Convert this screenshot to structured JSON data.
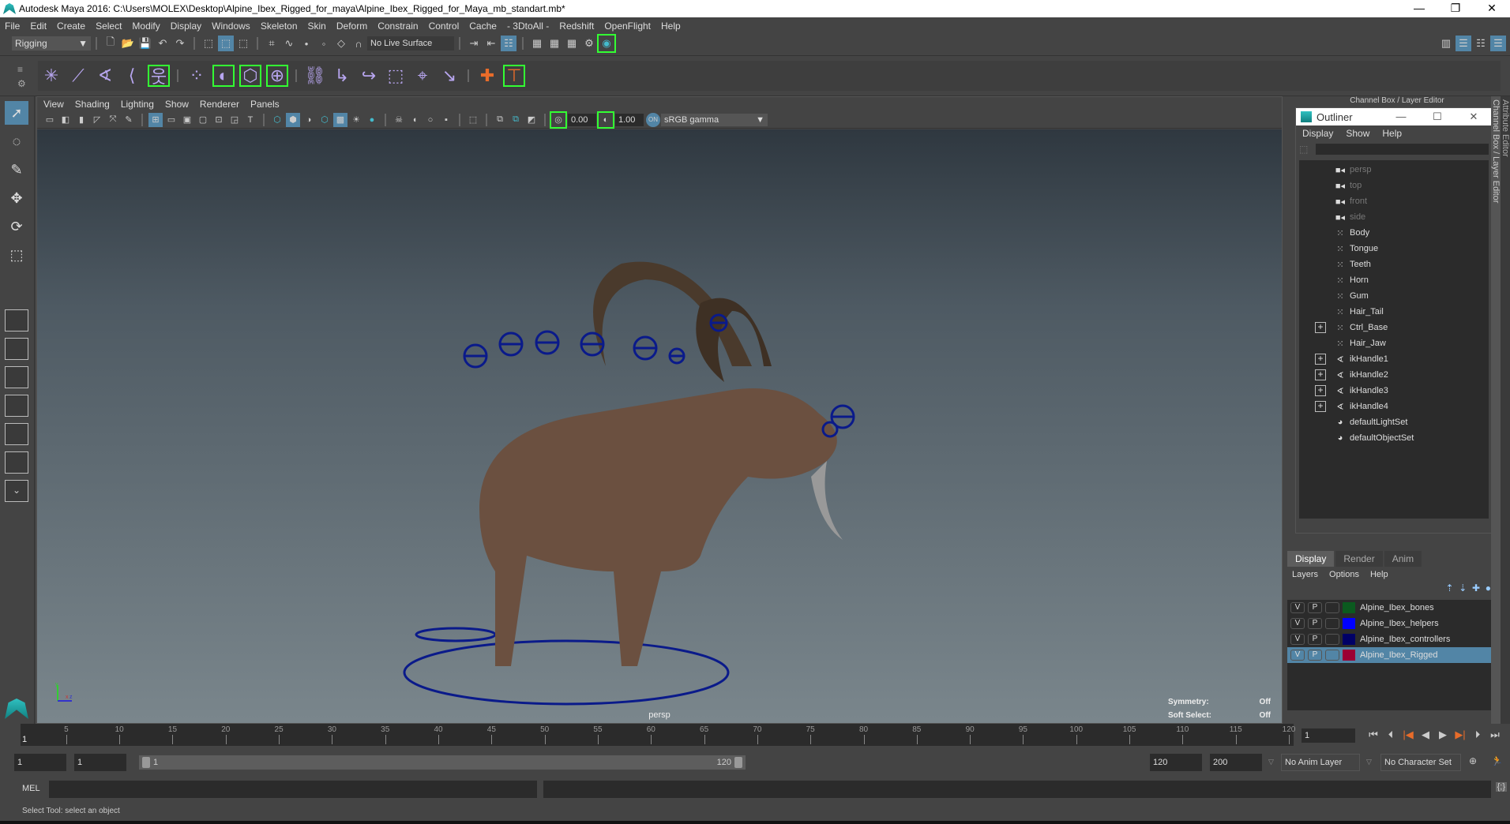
{
  "window": {
    "title": "Autodesk Maya 2016: C:\\Users\\MOLEX\\Desktop\\Alpine_Ibex_Rigged_for_maya\\Alpine_Ibex_Rigged_for_Maya_mb_standart.mb*",
    "minimize": "—",
    "maximize": "❐",
    "close": "✕"
  },
  "menubar": [
    "File",
    "Edit",
    "Create",
    "Select",
    "Modify",
    "Display",
    "Windows",
    "Skeleton",
    "Skin",
    "Deform",
    "Constrain",
    "Control",
    "Cache",
    "- 3DtoAll -",
    "Redshift",
    "OpenFlight",
    "Help"
  ],
  "statusline": {
    "mode": "Rigging",
    "live_surface": "No Live Surface"
  },
  "panel": {
    "menu": [
      "View",
      "Shading",
      "Lighting",
      "Show",
      "Renderer",
      "Panels"
    ],
    "exposure": "0.00",
    "gamma": "1.00",
    "color_space": "sRGB gamma",
    "camera_label": "persp",
    "hud": [
      {
        "label": "Symmetry:",
        "value": "Off"
      },
      {
        "label": "Soft Select:",
        "value": "Off"
      }
    ],
    "axis": {
      "y": "y",
      "x": "x",
      "z": "z"
    }
  },
  "dock": {
    "title": "Channel Box / Layer Editor",
    "side_tabs": [
      "Attribute Editor",
      "Channel Box / Layer Editor"
    ]
  },
  "outliner": {
    "title": "Outliner",
    "menu": [
      "Display",
      "Show",
      "Help"
    ],
    "items": [
      {
        "name": "persp",
        "type": "camera",
        "expandable": false
      },
      {
        "name": "top",
        "type": "camera",
        "expandable": false
      },
      {
        "name": "front",
        "type": "camera",
        "expandable": false
      },
      {
        "name": "side",
        "type": "camera",
        "expandable": false
      },
      {
        "name": "Body",
        "type": "mesh",
        "expandable": false
      },
      {
        "name": "Tongue",
        "type": "mesh",
        "expandable": false
      },
      {
        "name": "Teeth",
        "type": "mesh",
        "expandable": false
      },
      {
        "name": "Horn",
        "type": "mesh",
        "expandable": false
      },
      {
        "name": "Gum",
        "type": "mesh",
        "expandable": false
      },
      {
        "name": "Hair_Tail",
        "type": "mesh",
        "expandable": false
      },
      {
        "name": "Ctrl_Base",
        "type": "mesh",
        "expandable": true
      },
      {
        "name": "Hair_Jaw",
        "type": "mesh",
        "expandable": false
      },
      {
        "name": "ikHandle1",
        "type": "ik",
        "expandable": true
      },
      {
        "name": "ikHandle2",
        "type": "ik",
        "expandable": true
      },
      {
        "name": "ikHandle3",
        "type": "ik",
        "expandable": true
      },
      {
        "name": "ikHandle4",
        "type": "ik",
        "expandable": true
      },
      {
        "name": "defaultLightSet",
        "type": "set",
        "expandable": false
      },
      {
        "name": "defaultObjectSet",
        "type": "set",
        "expandable": false
      }
    ]
  },
  "layers": {
    "tabs": [
      "Display",
      "Render",
      "Anim"
    ],
    "active_tab": "Display",
    "menu": [
      "Layers",
      "Options",
      "Help"
    ],
    "items": [
      {
        "v": "V",
        "p": "P",
        "name": "Alpine_Ibex_bones",
        "color": "#0b5a1f",
        "selected": false
      },
      {
        "v": "V",
        "p": "P",
        "name": "Alpine_Ibex_helpers",
        "color": "#0000ff",
        "selected": false
      },
      {
        "v": "V",
        "p": "P",
        "name": "Alpine_Ibex_controllers",
        "color": "#000066",
        "selected": false
      },
      {
        "v": "V",
        "p": "P",
        "name": "Alpine_Ibex_Rigged",
        "color": "#9b0033",
        "selected": true
      }
    ]
  },
  "timeline": {
    "start": 1,
    "end": 120,
    "ticks": [
      5,
      10,
      15,
      20,
      25,
      30,
      35,
      40,
      45,
      50,
      55,
      60,
      65,
      70,
      75,
      80,
      85,
      90,
      95,
      100,
      105,
      110,
      115,
      120
    ],
    "current_frame": "1",
    "current_marker": "1"
  },
  "range": {
    "start": "1",
    "playback_start": "1",
    "slider_start": "1",
    "slider_end": "120",
    "playback_end": "120",
    "end": "200",
    "anim_layer": "No Anim Layer",
    "character_set": "No Character Set"
  },
  "command": {
    "label": "MEL"
  },
  "help_line": "Select Tool: select an object"
}
